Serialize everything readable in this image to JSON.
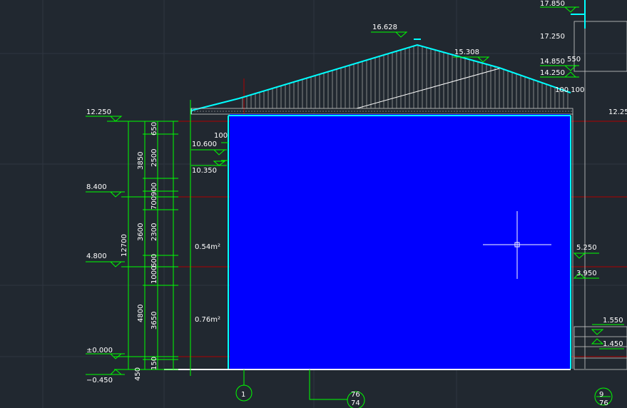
{
  "colors": {
    "background": "#212830",
    "grid": "#2e3640",
    "dimension": "#00ff00",
    "outline": "#00ffff",
    "fill": "#0000ff",
    "axis_line": "#cc0000",
    "text": "#ffffff"
  },
  "elevations": {
    "e17850": "17.850",
    "e17250": "17.250",
    "e16628": "16.628",
    "e15308": "15.308",
    "e14850": "14.850",
    "e14250": "14.250",
    "e12250_left": "12.250",
    "e12250_right": "12.25",
    "e10600": "10.600",
    "e10350": "10.350",
    "e8400": "8.400",
    "e5250": "5.250",
    "e4800": "4.800",
    "e3950": "3.950",
    "e1550": "1.550",
    "e1450": "1.450",
    "e0000": "±0.000",
    "em0450": "−0.450"
  },
  "dimensions": {
    "total": "12700",
    "seg_outer": [
      "4800",
      "3600",
      "3850",
      "450"
    ],
    "seg_inner": [
      "650",
      "2500",
      "900",
      "700",
      "2300",
      "600",
      "1000",
      "3650",
      "150"
    ],
    "d100": "100",
    "d550": "550",
    "d100_100": "100  100"
  },
  "areas": {
    "upper": "0.54m²",
    "lower": "0.76m²"
  },
  "grid_axes": {
    "axis1": "1",
    "axis_mid": "76\n74",
    "axis_right": "9\n76"
  },
  "cursor": {
    "type": "crosshair"
  }
}
